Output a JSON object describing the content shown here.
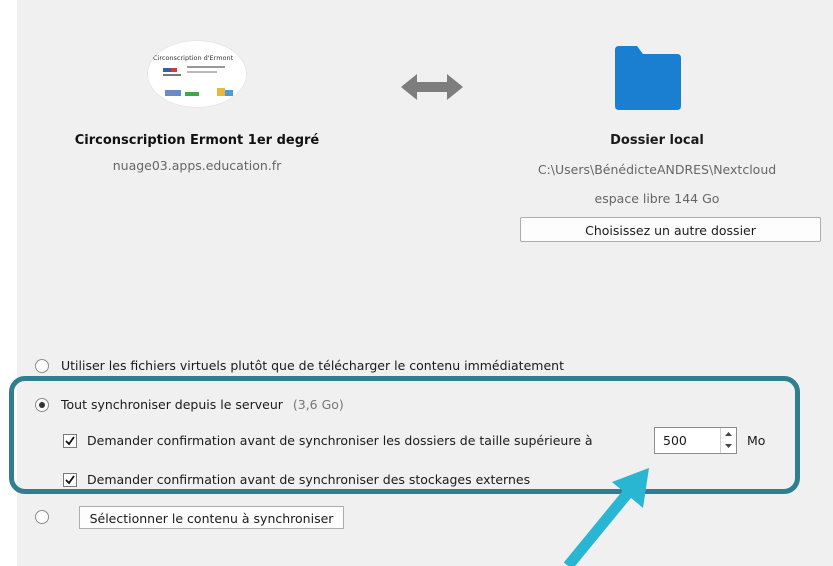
{
  "server": {
    "logo_text": "Circonscription d'Ermont",
    "name": "Circonscription Ermont 1er degré",
    "url": "nuage03.apps.education.fr"
  },
  "local": {
    "title": "Dossier local",
    "path": "C:\\Users\\BénédicteANDRES\\Nextcloud",
    "free_space": "espace libre 144 Go",
    "choose_button": "Choisissez un autre dossier"
  },
  "options": {
    "virtual_files": "Utiliser les fichiers virtuels plutôt que de télécharger le contenu immédiatement",
    "sync_all": "Tout synchroniser depuis le serveur",
    "sync_all_size": "(3,6 Go)",
    "confirm_large_folders": "Demander confirmation avant de synchroniser les dossiers de taille supérieure à",
    "size_limit_value": "500",
    "size_unit": "Mo",
    "confirm_external": "Demander confirmation avant de synchroniser des stockages externes",
    "select_content_button": "Sélectionner le contenu à synchroniser"
  },
  "state": {
    "selected_mode": "sync_all",
    "confirm_large_checked": true,
    "confirm_external_checked": true
  },
  "colors": {
    "folder": "#1a7fd1",
    "highlight": "#2f7f90",
    "annotation_arrow": "#29b6d3"
  }
}
